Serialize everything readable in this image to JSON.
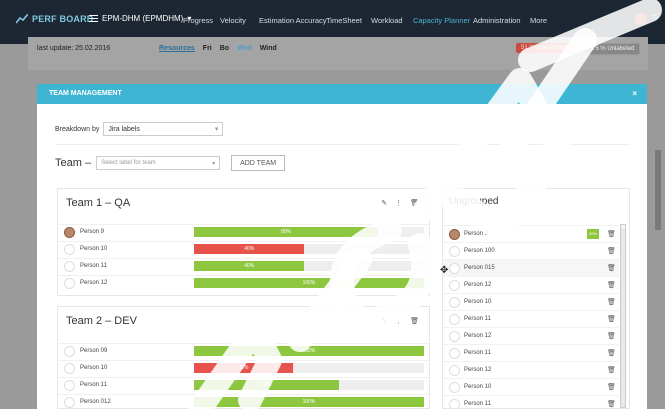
{
  "nav": {
    "brand": "PERF BOARD",
    "project": "EPM-DHM (EPMDHM)",
    "items": [
      "Progress",
      "Velocity",
      "Estimation Accuracy",
      "TimeSheet",
      "Workload",
      "Capacity Planner",
      "Administration",
      "More"
    ],
    "active_item": "Capacity Planner"
  },
  "page": {
    "last_update": "last update: 25.02.2016",
    "modes": [
      "Resources",
      "Fri",
      "Bo",
      "Wed",
      "Wind"
    ],
    "badge_unestimated": "51 % Unestimated",
    "badge_unlabeled": "75 % Unlabeled"
  },
  "modal": {
    "title": "TEAM MANAGEMENT",
    "close": "×",
    "breakdown_label": "Breakdown by",
    "breakdown_value": "Jira labels",
    "team_label": "Team –",
    "team_placeholder": "Select label for team",
    "add_team": "ADD TEAM",
    "teams": [
      {
        "name": "Team 1 – QA",
        "members": [
          {
            "name": "Person 9",
            "pct": 80,
            "label": "80%",
            "color": "green",
            "photo": true
          },
          {
            "name": "Person 10",
            "pct": 40,
            "label": "40%",
            "color": "red",
            "photo": false
          },
          {
            "name": "Person 11",
            "pct": 40,
            "label": "40%",
            "color": "green",
            "photo": false
          },
          {
            "name": "Person 12",
            "pct": 100,
            "label": "100%",
            "color": "green",
            "photo": false
          }
        ]
      },
      {
        "name": "Team 2 – DEV",
        "members": [
          {
            "name": "Person 09",
            "pct": 100,
            "label": "100%",
            "color": "green",
            "photo": false
          },
          {
            "name": "Person 10",
            "pct": 32,
            "label": "32%",
            "color": "red",
            "photo": false
          },
          {
            "name": "Person 11",
            "pct": 50,
            "label": "50%",
            "color": "green",
            "photo": false
          },
          {
            "name": "Person 012",
            "pct": 100,
            "label": "100%",
            "color": "green",
            "photo": false
          }
        ]
      }
    ],
    "ungrouped": {
      "title": "Ungrouped",
      "items": [
        {
          "name": "Person 9",
          "photo": true,
          "mini": "30%"
        },
        {
          "name": "Person 100"
        },
        {
          "name": "Person 015",
          "highlight": true
        },
        {
          "name": "Person 12"
        },
        {
          "name": "Person 10"
        },
        {
          "name": "Person 11"
        },
        {
          "name": "Person 12"
        },
        {
          "name": "Person 11"
        },
        {
          "name": "Person 12"
        },
        {
          "name": "Person 10"
        },
        {
          "name": "Person 11"
        }
      ]
    }
  },
  "colors": {
    "accent": "#3fb5d4",
    "green": "#8dc63f",
    "red": "#e5534b",
    "nav_bg": "#1d2733"
  }
}
